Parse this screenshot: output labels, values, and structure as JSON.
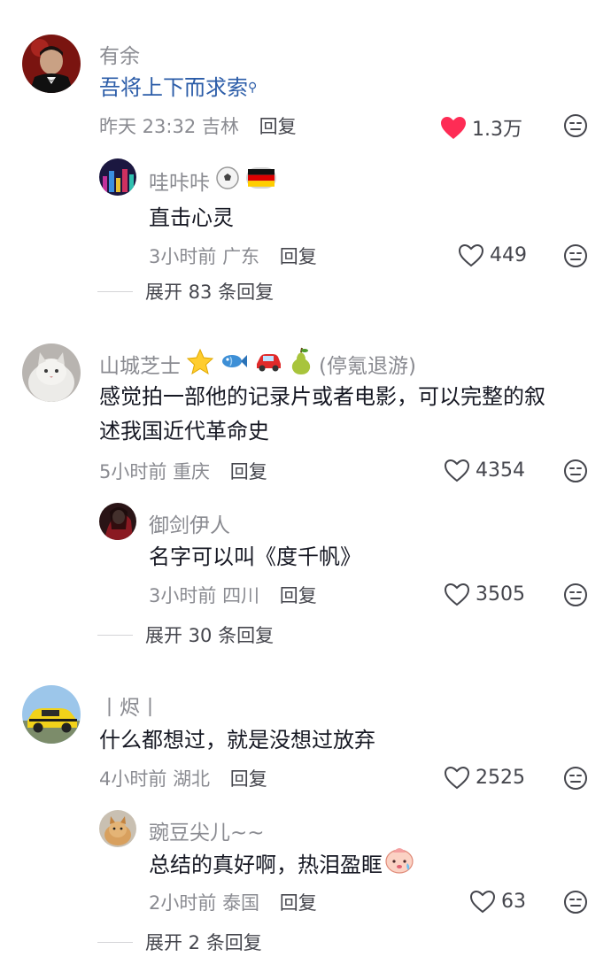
{
  "comments": [
    {
      "name": "有余",
      "text": "吾将上下而求索",
      "time": "昨天 23:32",
      "location": "吉林",
      "reply_label": "回复",
      "likes": "1.3万",
      "liked": true,
      "replies": [
        {
          "name": "哇咔咔",
          "text": "直击心灵",
          "time": "3小时前",
          "location": "广东",
          "reply_label": "回复",
          "likes": "449"
        }
      ],
      "expand_label": "展开 83 条回复"
    },
    {
      "name": "山城芝士",
      "name_suffix": "(停氪退游)",
      "text_line1": "感觉拍一部他的记录片或者电影，可以完整的叙",
      "text_line2": "述我国近代革命史",
      "time": "5小时前",
      "location": "重庆",
      "reply_label": "回复",
      "likes": "4354",
      "replies": [
        {
          "name": "御剑伊人",
          "text": "名字可以叫《度千帆》",
          "time": "3小时前",
          "location": "四川",
          "reply_label": "回复",
          "likes": "3505"
        }
      ],
      "expand_label": "展开 30 条回复"
    },
    {
      "name": "丨烬丨",
      "text": "什么都想过，就是没想过放弃",
      "time": "4小时前",
      "location": "湖北",
      "reply_label": "回复",
      "likes": "2525",
      "replies": [
        {
          "name": "豌豆尖儿~~",
          "text": "总结的真好啊，热泪盈眶",
          "time": "2小时前",
          "location": "泰国",
          "reply_label": "回复",
          "likes": "63"
        }
      ],
      "expand_label": "展开 2 条回复"
    }
  ],
  "icons": {
    "heart_filled": "heart-filled-icon",
    "heart_outline": "heart-outline-icon",
    "dislike": "dislike-face-icon",
    "search_superscript": "search-icon"
  },
  "colors": {
    "liked_heart": "#fe2c55",
    "link_text": "#2b5ca8"
  }
}
